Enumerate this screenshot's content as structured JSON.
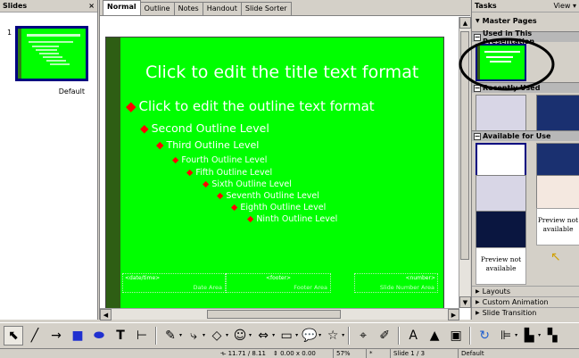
{
  "slides_pane": {
    "title": "Slides",
    "close": "×",
    "slide_number": "1",
    "thumb_label": "Default"
  },
  "tabs": [
    "Normal",
    "Outline",
    "Notes",
    "Handout",
    "Slide Sorter"
  ],
  "slide": {
    "title": "Click to edit the title text format",
    "outline_levels": [
      "Click to edit the outline text format",
      "Second Outline Level",
      "Third Outline Level",
      "Fourth Outline Level",
      "Fifth Outline Level",
      "Sixth Outline Level",
      "Seventh Outline Level",
      "Eighth Outline Level",
      "Ninth Outline Level"
    ],
    "footer": {
      "date_field": "<date/time>",
      "date_area": "Date Area",
      "footer_field": "<footer>",
      "footer_area": "Footer Area",
      "number_field": "<number>",
      "number_area": "Slide Number Area"
    },
    "colors": {
      "background": "#00ff00",
      "sidebar": "#2e5e14",
      "bullet": "#ff0000",
      "text": "#ffffff"
    }
  },
  "tasks": {
    "title": "Tasks",
    "view": "View",
    "master_pages": "Master Pages",
    "used_in_presentation": "Used in This Presentation",
    "recently_used": "Recently Used",
    "available_for_use": "Available for Use",
    "preview_not_available": "Preview not available",
    "items": [
      "Layouts",
      "Custom Animation",
      "Slide Transition"
    ]
  },
  "toolbar": {
    "icons": [
      "select-icon",
      "line-icon",
      "arrow-line-icon",
      "rectangle-icon",
      "ellipse-icon",
      "text-icon",
      "dimension-line-icon",
      "curve-icon",
      "connector-icon",
      "basic-shapes-icon",
      "symbol-shapes-icon",
      "block-arrows-icon",
      "flowchart-icon",
      "callouts-icon",
      "stars-icon",
      "points-icon",
      "gluepoints-icon",
      "fontwork-icon",
      "from-file-icon",
      "extrusion-icon",
      "rotate-icon",
      "align-icon",
      "arrange-icon",
      "shadow-icon"
    ]
  },
  "statusbar": {
    "position": "11.71 / 8.11",
    "size": "0.00 x 0.00",
    "zoom": "57%",
    "modified": "*",
    "slide": "Slide 1 / 3",
    "layout": "Default"
  }
}
